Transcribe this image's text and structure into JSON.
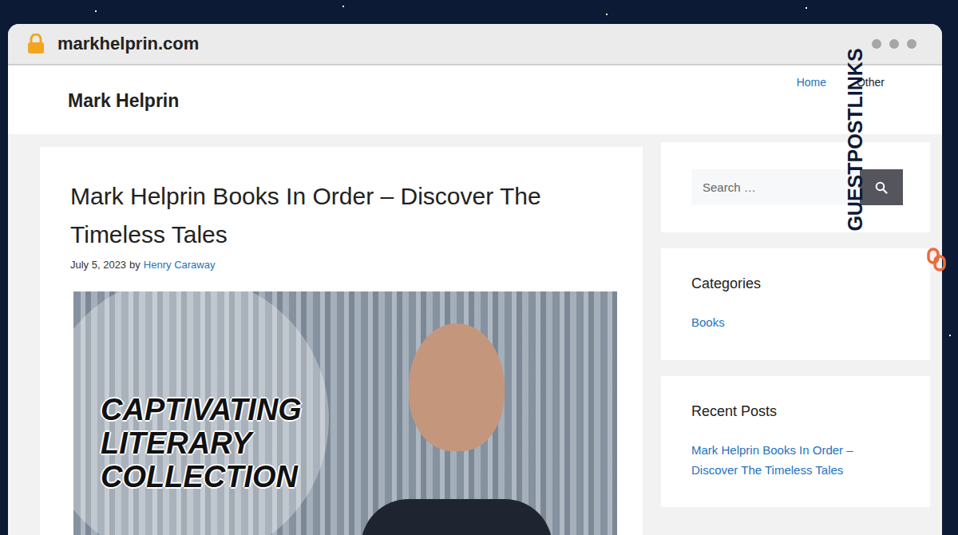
{
  "browser": {
    "url": "markhelprin.com"
  },
  "badge": {
    "text": "GUESTPOSTLINKS"
  },
  "site": {
    "title": "Mark Helprin",
    "nav": [
      {
        "label": "Home",
        "selected": true
      },
      {
        "label": "Other",
        "selected": false
      }
    ]
  },
  "post": {
    "title": "Mark Helprin Books In Order – Discover The Timeless Tales",
    "date": "July 5, 2023",
    "by": "by",
    "author": "Henry Caraway",
    "banner": [
      "CAPTIVATING",
      "LITERARY",
      "COLLECTION"
    ]
  },
  "sidebar": {
    "search": {
      "placeholder": "Search …"
    },
    "categories": {
      "heading": "Categories",
      "items": [
        "Books"
      ]
    },
    "recent_posts": {
      "heading": "Recent Posts",
      "items": [
        "Mark Helprin Books In Order – Discover The Timeless Tales"
      ]
    }
  }
}
